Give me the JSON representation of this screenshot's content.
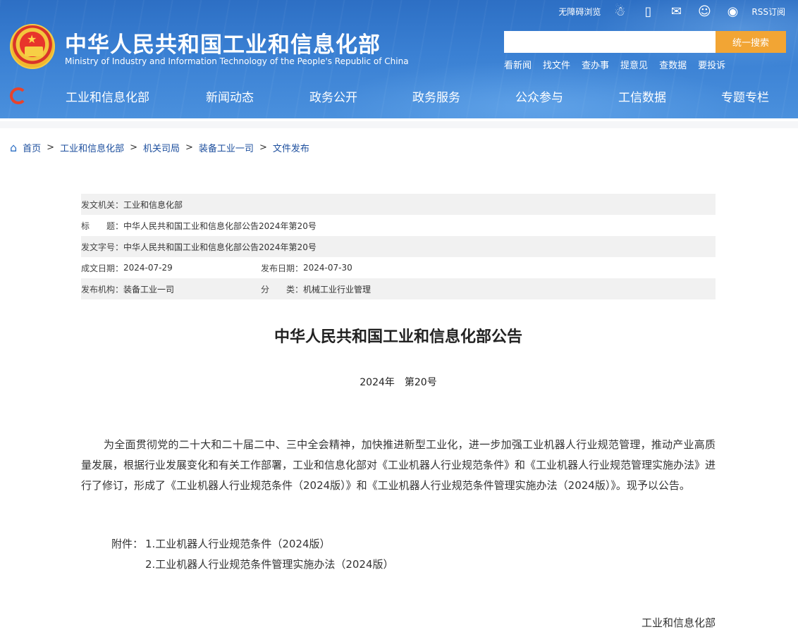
{
  "header": {
    "title_cn": "中华人民共和国工业和信息化部",
    "title_en": "Ministry of Industry and Information Technology of the People's Republic of China",
    "top_links": {
      "accessibility": "无障碍浏览",
      "rss": "RSS订阅"
    },
    "search": {
      "placeholder": "",
      "button_label": "统一搜索"
    },
    "quick_links": [
      "看新闻",
      "找文件",
      "查办事",
      "提意见",
      "查数据",
      "要投诉"
    ],
    "nav": [
      "工业和信息化部",
      "新闻动态",
      "政务公开",
      "政务服务",
      "公众参与",
      "工信数据",
      "专题专栏"
    ]
  },
  "breadcrumb": [
    "首页",
    "工业和信息化部",
    "机关司局",
    "装备工业一司",
    "文件发布"
  ],
  "meta": {
    "issuer_label": "发文机关：",
    "issuer": "工业和信息化部",
    "title_label": "标　　题：",
    "title": "中华人民共和国工业和信息化部公告2024年第20号",
    "doc_no_label": "发文字号：",
    "doc_no": "中华人民共和国工业和信息化部公告2024年第20号",
    "created_label": "成文日期：",
    "created": "2024-07-29",
    "published_label": "发布日期：",
    "published": "2024-07-30",
    "org_label": "发布机构：",
    "org": "装备工业一司",
    "category_label": "分　　类：",
    "category": "机械工业行业管理"
  },
  "article": {
    "title": "中华人民共和国工业和信息化部公告",
    "number": "2024年　第20号",
    "body": "为全面贯彻党的二十大和二十届二中、三中全会精神，加快推进新型工业化，进一步加强工业机器人行业规范管理，推动产业高质量发展，根据行业发展变化和有关工作部署，工业和信息化部对《工业机器人行业规范条件》和《工业机器人行业规范管理实施办法》进行了修订，形成了《工业机器人行业规范条件（2024版）》和《工业机器人行业规范条件管理实施办法（2024版）》。现予以公告。",
    "attachments_label": "附件：",
    "attachments": [
      "1.工业机器人行业规范条件（2024版）",
      "2.工业机器人行业规范条件管理实施办法（2024版）"
    ],
    "signature": "工业和信息化部"
  },
  "icons": {
    "accessibility": "person-icon",
    "mobile": "mobile-icon",
    "mail": "mail-icon",
    "wechat": "wechat-icon",
    "weibo": "weibo-icon",
    "home": "home-icon"
  },
  "colors": {
    "header_blue": "#3a80d3",
    "search_button": "#f2a534",
    "link_blue": "#1d4f9e"
  }
}
